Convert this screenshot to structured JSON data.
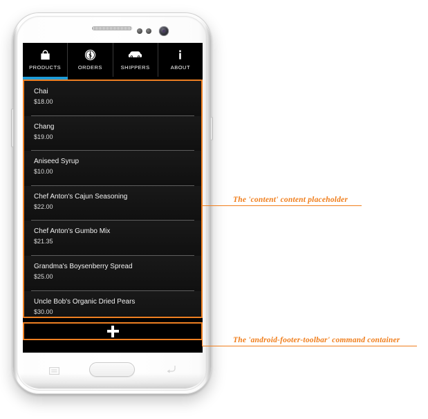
{
  "device": {
    "type": "android-phone-mockup",
    "hardware": {
      "speaker": "speaker-grille",
      "sensors": "proximity-sensor-dots",
      "camera": "front-camera",
      "home": "home-button",
      "menu_key": "menu-icon",
      "back_key": "back-arrow-icon",
      "volume": "volume-rocker",
      "power": "power-button"
    }
  },
  "app": {
    "tabbar": {
      "active_index": 0,
      "active_color": "#1e9bd7",
      "tabs": [
        {
          "label": "PRODUCTS",
          "icon": "shopping-bag-icon"
        },
        {
          "label": "ORDERS",
          "icon": "dollar-coin-icon"
        },
        {
          "label": "SHIPPERS",
          "icon": "car-icon"
        },
        {
          "label": "ABOUT",
          "icon": "info-icon"
        }
      ]
    },
    "content": {
      "rows": [
        {
          "title": "Chai",
          "price": "$18.00"
        },
        {
          "title": "Chang",
          "price": "$19.00"
        },
        {
          "title": "Aniseed Syrup",
          "price": "$10.00"
        },
        {
          "title": "Chef Anton's Cajun Seasoning",
          "price": "$22.00"
        },
        {
          "title": "Chef Anton's Gumbo Mix",
          "price": "$21.35"
        },
        {
          "title": "Grandma's Boysenberry Spread",
          "price": "$25.00"
        },
        {
          "title": "Uncle Bob's Organic Dried Pears",
          "price": "$30.00"
        }
      ]
    },
    "footer": {
      "add_label": "+",
      "add_icon": "plus-icon"
    }
  },
  "annotations": {
    "color": "#f07d1a",
    "items": [
      {
        "text": "The 'content' content placeholder"
      },
      {
        "text": "The 'android-footer-toolbar' command container"
      }
    ]
  }
}
